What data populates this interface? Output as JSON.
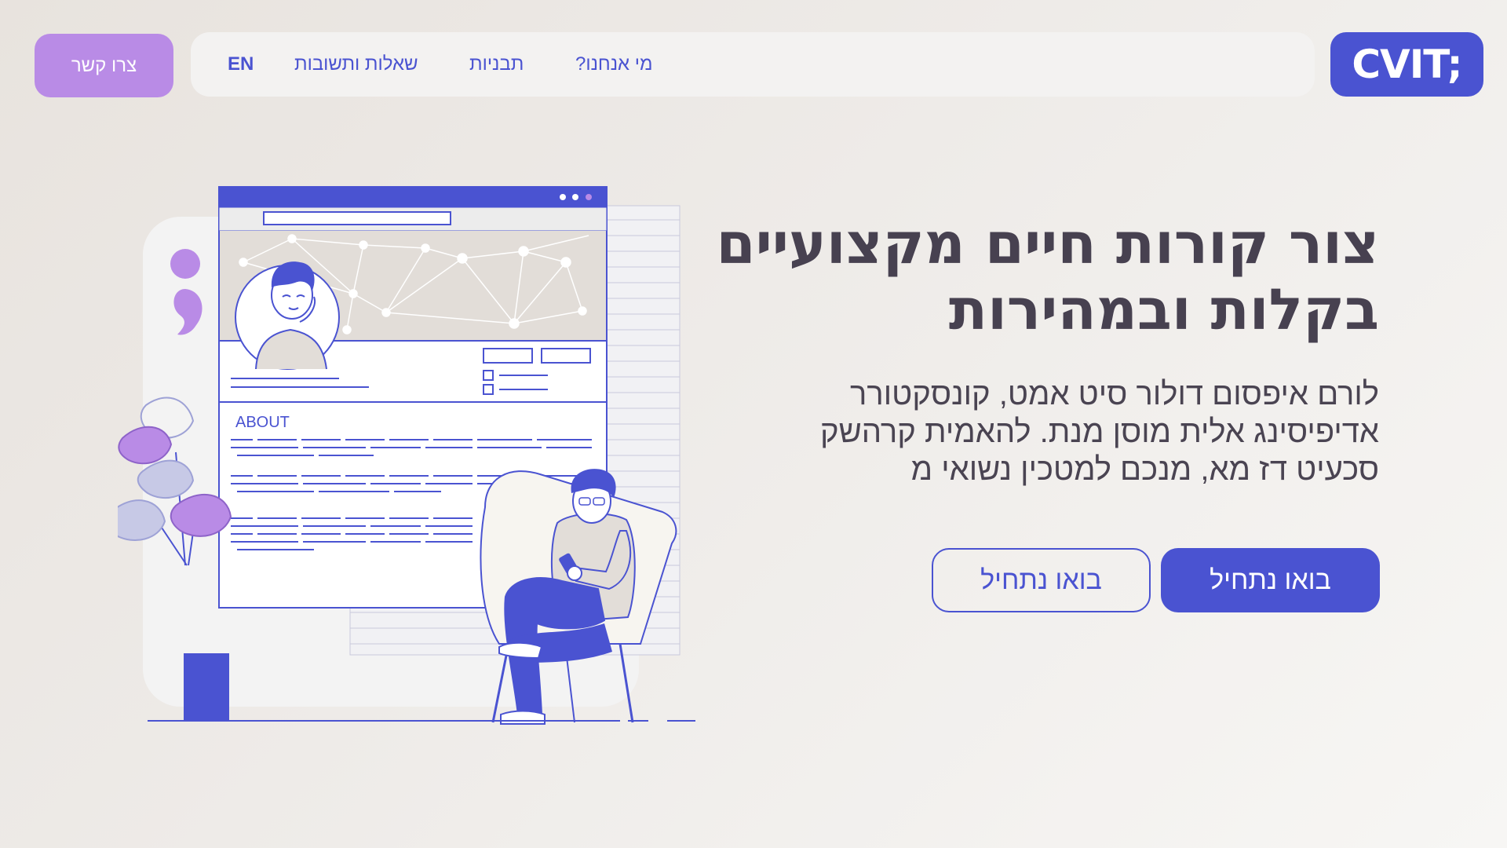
{
  "header": {
    "logo_text": "CVIT;",
    "nav": {
      "about": "מי אנחנו?",
      "templates": "תבניות",
      "faq": "שאלות ותשובות",
      "language": "EN"
    },
    "contact_label": "צרו קשר"
  },
  "hero": {
    "title": "צור קורות חיים מקצועיים בקלות ובמהירות",
    "description": "לורם איפסום דולור סיט אמט, קונסקטורר אדיפיסינג אלית מוסן מנת. להאמית קרהשק סכעיט דז מא, מנכם למטכין נשואי מ",
    "primary_cta": "בואו נתחיל",
    "secondary_cta": "בואו נתחיל"
  },
  "illustration": {
    "about_heading": "ABOUT"
  },
  "colors": {
    "brand_blue": "#4a53d1",
    "accent_purple": "#b98be6",
    "text_dark": "#474150"
  }
}
